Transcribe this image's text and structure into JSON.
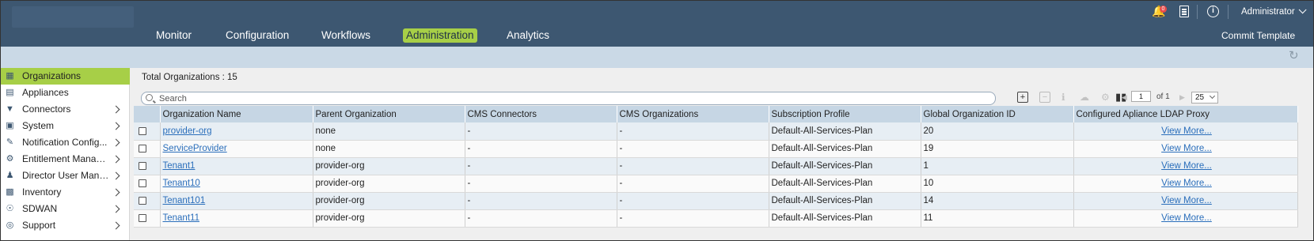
{
  "header": {
    "nav": [
      "Monitor",
      "Configuration",
      "Workflows",
      "Administration",
      "Analytics"
    ],
    "active_nav": "Administration",
    "notification_count": "0",
    "user_menu": "Administrator",
    "commit_label": "Commit Template"
  },
  "sidebar": {
    "items": [
      {
        "label": "Organizations",
        "icon": "organizations-icon",
        "active": true,
        "chevron": false
      },
      {
        "label": "Appliances",
        "icon": "appliances-icon",
        "active": false,
        "chevron": false
      },
      {
        "label": "Connectors",
        "icon": "connectors-icon",
        "active": false,
        "chevron": true
      },
      {
        "label": "System",
        "icon": "system-icon",
        "active": false,
        "chevron": true
      },
      {
        "label": "Notification Config...",
        "icon": "notification-config-icon",
        "active": false,
        "chevron": true
      },
      {
        "label": "Entitlement Manager",
        "icon": "entitlement-icon",
        "active": false,
        "chevron": true
      },
      {
        "label": "Director User Mana...",
        "icon": "users-icon",
        "active": false,
        "chevron": true
      },
      {
        "label": "Inventory",
        "icon": "inventory-icon",
        "active": false,
        "chevron": true
      },
      {
        "label": "SDWAN",
        "icon": "sdwan-icon",
        "active": false,
        "chevron": true
      },
      {
        "label": "Support",
        "icon": "support-icon",
        "active": false,
        "chevron": true
      }
    ]
  },
  "main": {
    "total_label": "Total Organizations : 15",
    "search_placeholder": "Search",
    "page_current": "1",
    "page_of": "of 1",
    "page_size": "25"
  },
  "table": {
    "columns": [
      "Organization Name",
      "Parent Organization",
      "CMS Connectors",
      "CMS Organizations",
      "Subscription Profile",
      "Global Organization ID",
      "Configured Apliance LDAP Proxy"
    ],
    "rows": [
      [
        "provider-org",
        "none",
        "-",
        "-",
        "Default-All-Services-Plan",
        "20",
        "View More..."
      ],
      [
        "ServiceProvider",
        "none",
        "-",
        "-",
        "Default-All-Services-Plan",
        "19",
        "View More..."
      ],
      [
        "Tenant1",
        "provider-org",
        "-",
        "-",
        "Default-All-Services-Plan",
        "1",
        "View More..."
      ],
      [
        "Tenant10",
        "provider-org",
        "-",
        "-",
        "Default-All-Services-Plan",
        "10",
        "View More..."
      ],
      [
        "Tenant101",
        "provider-org",
        "-",
        "-",
        "Default-All-Services-Plan",
        "14",
        "View More..."
      ],
      [
        "Tenant11",
        "provider-org",
        "-",
        "-",
        "Default-All-Services-Plan",
        "11",
        "View More..."
      ]
    ]
  },
  "colors": {
    "header_bg": "#3d5771",
    "accent": "#a7cf47",
    "subbar_bg": "#cad9e6",
    "link": "#2a6ebb"
  }
}
